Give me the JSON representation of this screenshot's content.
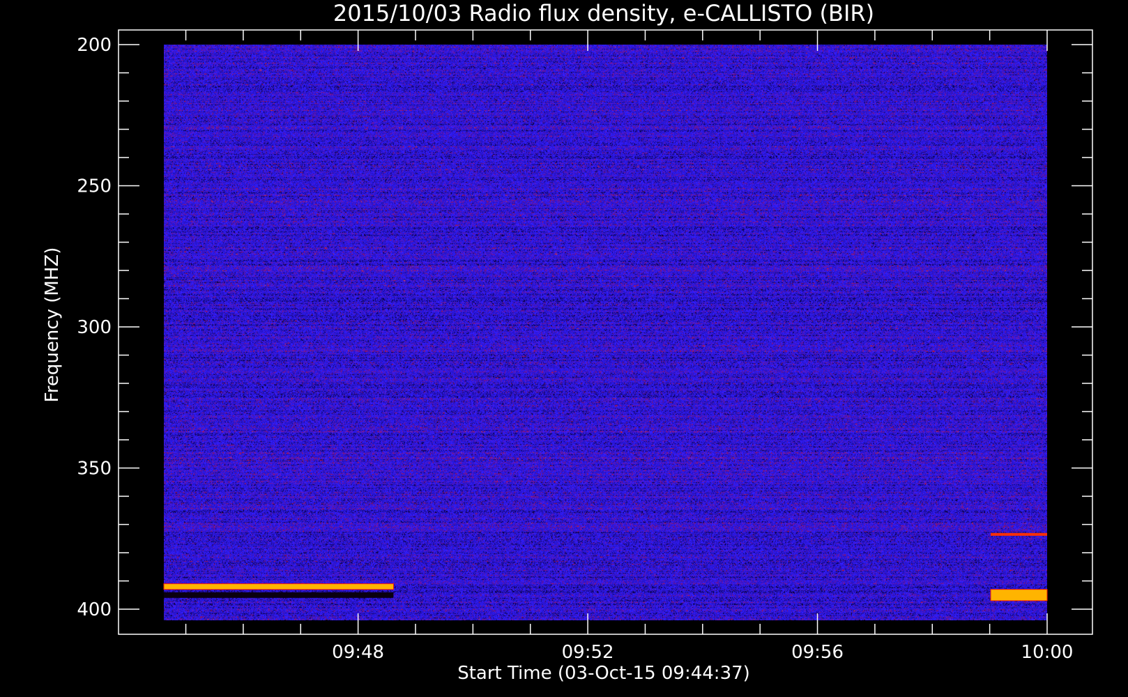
{
  "chart_data": {
    "type": "heatmap",
    "title": "2015/10/03  Radio flux density, e-CALLISTO (BIR)",
    "xlabel": "Start Time (03-Oct-15 09:44:37)",
    "ylabel": "Frequency (MHZ)",
    "x_tick_labels": [
      "09:48",
      "09:52",
      "09:56",
      "10:00"
    ],
    "x_ticks_minutes": [
      3.383,
      7.383,
      11.383,
      15.383
    ],
    "xlim_minutes": [
      0.0,
      15.383
    ],
    "y_tick_labels": [
      "200",
      "250",
      "300",
      "350",
      "400"
    ],
    "y_ticks": [
      200,
      250,
      300,
      350,
      400
    ],
    "ylim": [
      195,
      405
    ],
    "y_inverted": true,
    "grid": false,
    "colormap": [
      "#000000",
      "#1a00b0",
      "#2b1cff",
      "#b00000",
      "#ff2000",
      "#ffb000",
      "#ffff80"
    ],
    "background_level": "blue-purple noise",
    "features": [
      {
        "label": "",
        "start_minutes": 0.0,
        "end_minutes": 4.0,
        "freq_low": 391,
        "freq_high": 393,
        "intensity": "high"
      },
      {
        "label": "",
        "start_minutes": 0.0,
        "end_minutes": 4.0,
        "freq_low": 394,
        "freq_high": 396,
        "intensity": "low"
      },
      {
        "label": "",
        "start_minutes": 14.4,
        "end_minutes": 15.383,
        "freq_low": 393,
        "freq_high": 397,
        "intensity": "high"
      },
      {
        "label": "",
        "start_minutes": 14.4,
        "end_minutes": 15.383,
        "freq_low": 373,
        "freq_high": 374,
        "intensity": "medium"
      }
    ]
  },
  "colors": {
    "background": "#000000",
    "axis": "#ffffff",
    "noise_base": "#2a1ae0"
  }
}
